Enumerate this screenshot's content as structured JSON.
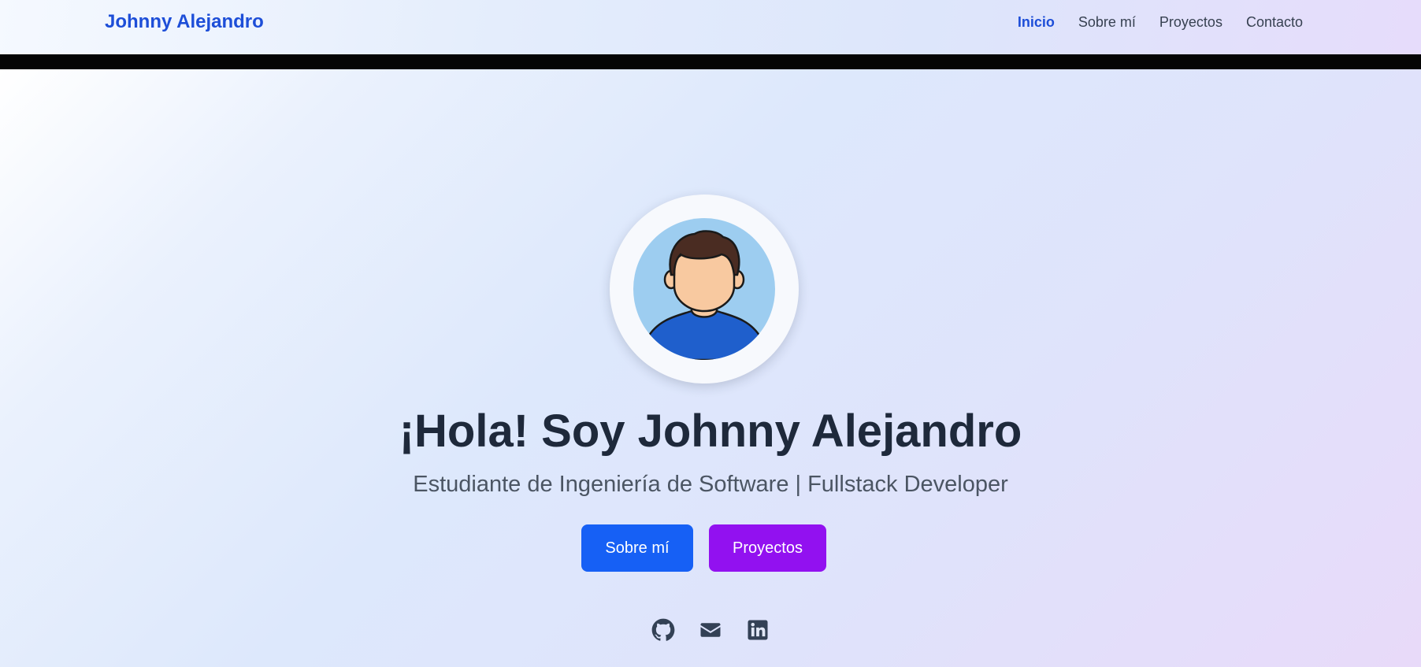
{
  "nav": {
    "brand": "Johnny Alejandro",
    "links": [
      {
        "label": "Inicio",
        "active": true
      },
      {
        "label": "Sobre mí",
        "active": false
      },
      {
        "label": "Proyectos",
        "active": false
      },
      {
        "label": "Contacto",
        "active": false
      }
    ]
  },
  "hero": {
    "title": "¡Hola! Soy Johnny Alejandro",
    "subtitle": "Estudiante de Ingeniería de Software | Fullstack Developer",
    "buttons": {
      "about": "Sobre mí",
      "projects": "Proyectos"
    }
  },
  "socials": [
    {
      "icon": "github-icon"
    },
    {
      "icon": "envelope-icon"
    },
    {
      "icon": "linkedin-icon"
    }
  ],
  "colors": {
    "brand": "#1d4ed8",
    "primary_button": "#1660f5",
    "secondary_button": "#9211f0",
    "title": "#1e293b",
    "subtitle": "#4b5563"
  }
}
